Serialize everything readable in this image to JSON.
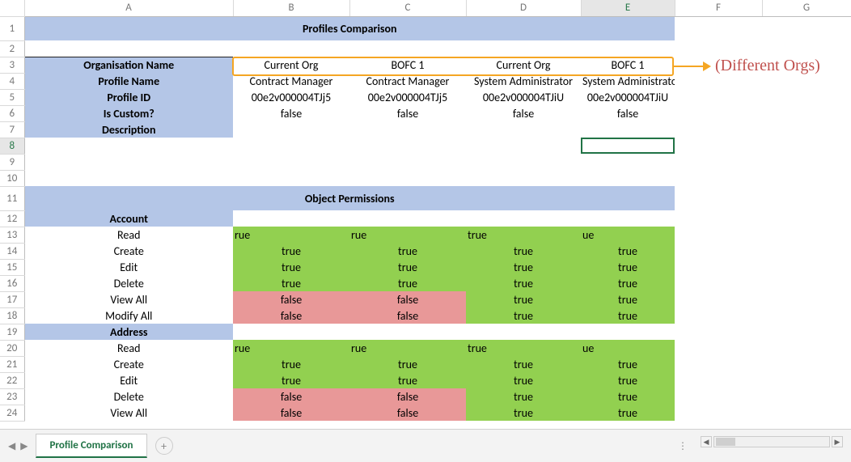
{
  "columns": [
    "A",
    "B",
    "C",
    "D",
    "E",
    "F",
    "G"
  ],
  "rows": [
    "1",
    "2",
    "3",
    "4",
    "5",
    "6",
    "7",
    "8",
    "9",
    "10",
    "11",
    "12",
    "13",
    "14",
    "15",
    "16",
    "17",
    "18",
    "19",
    "20",
    "21",
    "22",
    "23",
    "24"
  ],
  "title_profiles": "Profiles Comparison",
  "title_object_perm": "Object Permissions",
  "active_col": "E",
  "active_row": "8",
  "annotation": "(Different Orgs)",
  "header_rows": [
    {
      "label": "Organisation Name",
      "vals": [
        "Current Org",
        "BOFC 1",
        "Current Org",
        "BOFC 1"
      ]
    },
    {
      "label": "Profile Name",
      "vals": [
        "Contract Manager",
        "Contract Manager",
        "System Administrator",
        "System Administrator"
      ]
    },
    {
      "label": "Profile ID",
      "vals": [
        "00e2v000004TJj5",
        "00e2v000004TJj5",
        "00e2v000004TJiU",
        "00e2v000004TJiU"
      ]
    },
    {
      "label": "Is Custom?",
      "vals": [
        "false",
        "false",
        "false",
        "false"
      ]
    },
    {
      "label": "Description",
      "vals": [
        "",
        "",
        "",
        ""
      ]
    }
  ],
  "sections": [
    {
      "heading": "Account",
      "rows": [
        {
          "label": "Read",
          "style": "left",
          "vals": [
            "rue",
            "rue",
            "true",
            "ue"
          ]
        },
        {
          "label": "Create",
          "style": "center",
          "vals": [
            "true",
            "true",
            "true",
            "true"
          ],
          "colors": [
            "g",
            "g",
            "g",
            "g"
          ]
        },
        {
          "label": "Edit",
          "style": "center",
          "vals": [
            "true",
            "true",
            "true",
            "true"
          ],
          "colors": [
            "g",
            "g",
            "g",
            "g"
          ]
        },
        {
          "label": "Delete",
          "style": "center",
          "vals": [
            "true",
            "true",
            "true",
            "true"
          ],
          "colors": [
            "g",
            "g",
            "g",
            "g"
          ]
        },
        {
          "label": "View All",
          "style": "center",
          "vals": [
            "false",
            "false",
            "true",
            "true"
          ],
          "colors": [
            "r",
            "r",
            "g",
            "g"
          ]
        },
        {
          "label": "Modify All",
          "style": "center",
          "vals": [
            "false",
            "false",
            "true",
            "true"
          ],
          "colors": [
            "r",
            "r",
            "g",
            "g"
          ]
        }
      ]
    },
    {
      "heading": "Address",
      "rows": [
        {
          "label": "Read",
          "style": "left",
          "vals": [
            "rue",
            "rue",
            "true",
            "ue"
          ]
        },
        {
          "label": "Create",
          "style": "center",
          "vals": [
            "true",
            "true",
            "true",
            "true"
          ],
          "colors": [
            "g",
            "g",
            "g",
            "g"
          ]
        },
        {
          "label": "Edit",
          "style": "center",
          "vals": [
            "true",
            "true",
            "true",
            "true"
          ],
          "colors": [
            "g",
            "g",
            "g",
            "g"
          ]
        },
        {
          "label": "Delete",
          "style": "center",
          "vals": [
            "false",
            "false",
            "true",
            "true"
          ],
          "colors": [
            "r",
            "r",
            "g",
            "g"
          ]
        },
        {
          "label": "View All",
          "style": "center",
          "vals": [
            "false",
            "false",
            "true",
            "true"
          ],
          "colors": [
            "r",
            "r",
            "g",
            "g"
          ]
        }
      ]
    }
  ],
  "tab_name": "Profile Comparison",
  "nav": {
    "left": "◀",
    "right": "▶",
    "plus": "+",
    "dots": "⋮"
  }
}
